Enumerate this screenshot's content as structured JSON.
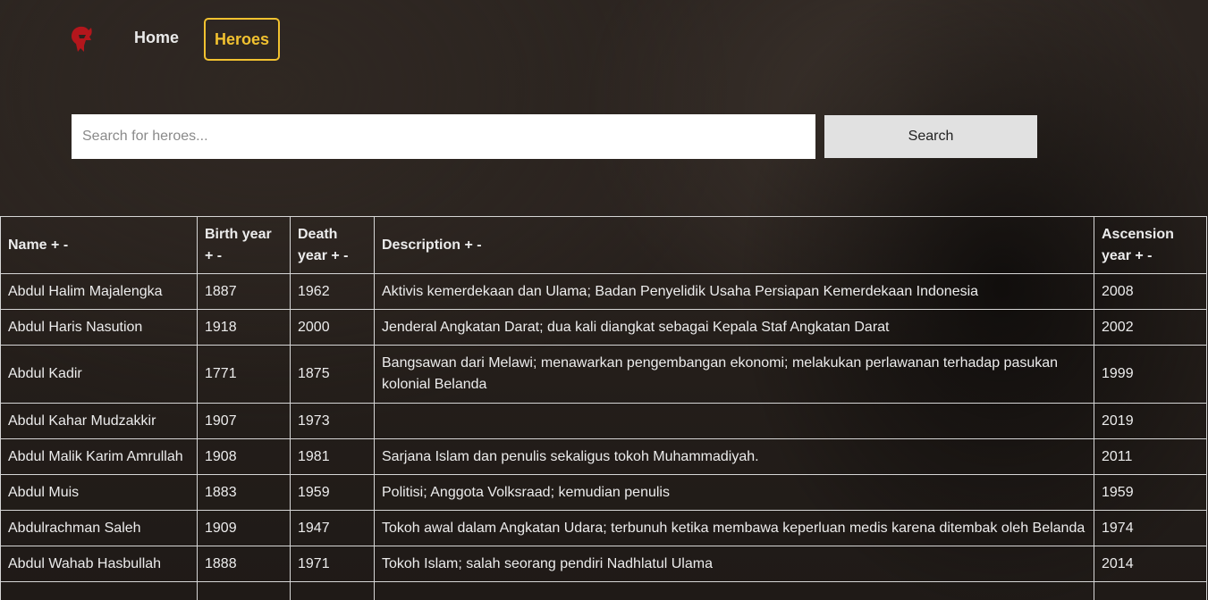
{
  "nav": {
    "logo_icon": "spartan-helmet-icon",
    "home_label": "Home",
    "heroes_label": "Heroes",
    "accent_color": "#f2c230",
    "logo_color": "#b3161c"
  },
  "search": {
    "placeholder": "Search for heroes...",
    "value": "",
    "button_label": "Search"
  },
  "table": {
    "headers": {
      "name": "Name",
      "birth_l1": "Birth year",
      "birth_l2": "+ -",
      "death_l1": "Death",
      "death_l2": "year + -",
      "description": "Description",
      "asc_l1": "Ascension",
      "asc_l2": "year + -",
      "sort_controls": "+ -"
    },
    "rows": [
      {
        "name": "Abdul Halim Majalengka",
        "birth": "1887",
        "death": "1962",
        "description": "Aktivis kemerdekaan dan Ulama; Badan Penyelidik Usaha Persiapan Kemerdekaan Indonesia",
        "ascension": "2008"
      },
      {
        "name": "Abdul Haris Nasution",
        "birth": "1918",
        "death": "2000",
        "description": "Jenderal Angkatan Darat; dua kali diangkat sebagai Kepala Staf Angkatan Darat",
        "ascension": "2002"
      },
      {
        "name": "Abdul Kadir",
        "birth": "1771",
        "death": "1875",
        "description": "Bangsawan dari Melawi; menawarkan pengembangan ekonomi; melakukan perlawanan terhadap pasukan kolonial Belanda",
        "ascension": "1999"
      },
      {
        "name": "Abdul Kahar Mudzakkir",
        "birth": "1907",
        "death": "1973",
        "description": "",
        "ascension": "2019"
      },
      {
        "name": "Abdul Malik Karim Amrullah",
        "birth": "1908",
        "death": "1981",
        "description": "Sarjana Islam dan penulis sekaligus tokoh Muhammadiyah.",
        "ascension": "2011"
      },
      {
        "name": "Abdul Muis",
        "birth": "1883",
        "death": "1959",
        "description": "Politisi; Anggota Volksraad; kemudian penulis",
        "ascension": "1959"
      },
      {
        "name": "Abdulrachman Saleh",
        "birth": "1909",
        "death": "1947",
        "description": "Tokoh awal dalam Angkatan Udara; terbunuh ketika membawa keperluan medis karena ditembak oleh Belanda",
        "ascension": "1974"
      },
      {
        "name": "Abdul Wahab Hasbullah",
        "birth": "1888",
        "death": "1971",
        "description": "Tokoh Islam; salah seorang pendiri Nadhlatul Ulama",
        "ascension": "2014"
      },
      {
        "name": "",
        "birth": "",
        "death": "",
        "description": "",
        "ascension": ""
      }
    ]
  }
}
